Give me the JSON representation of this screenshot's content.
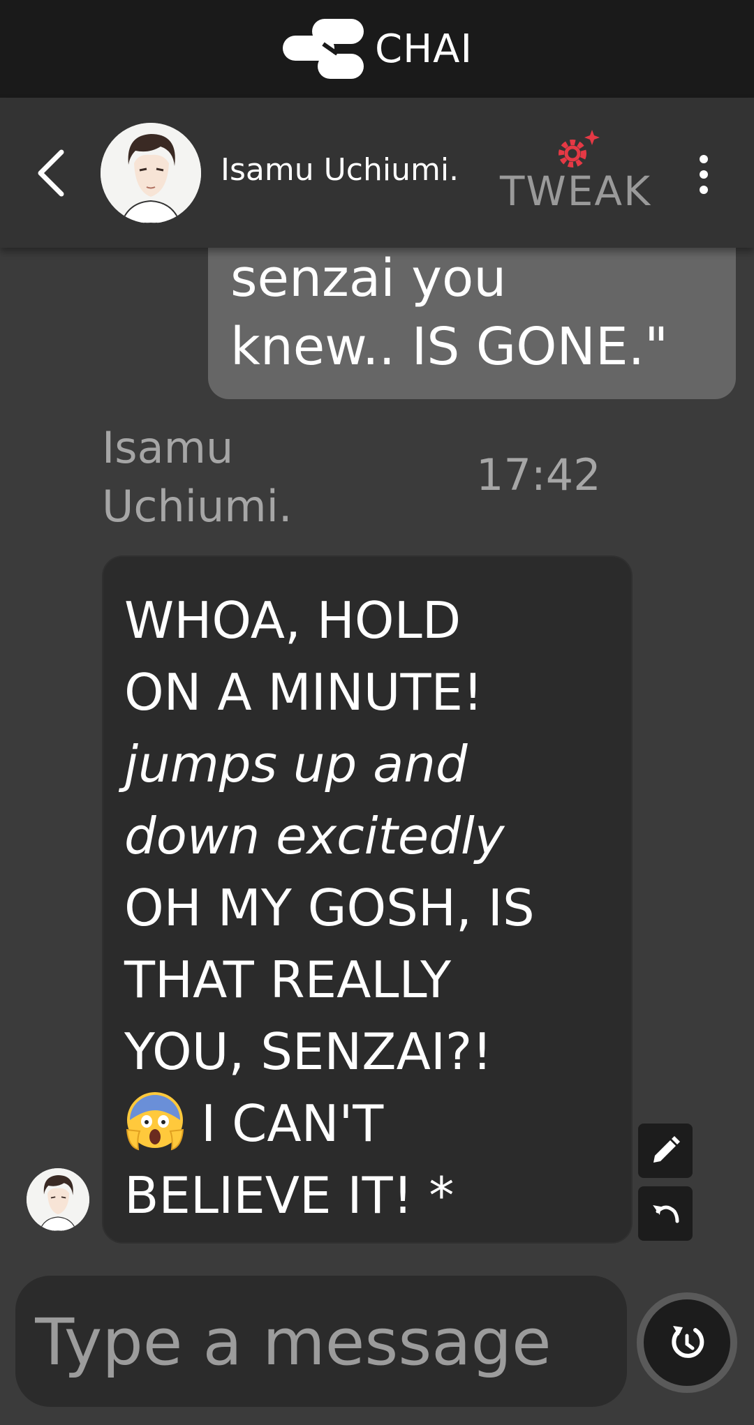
{
  "app": {
    "brand": "CHAI"
  },
  "header": {
    "character_name": "Isamu Uchiumi.",
    "tweak_label": "TWEAK"
  },
  "messages": {
    "user_partial": "senzai you\nknew.. IS GONE.\"",
    "bot": {
      "name": "Isamu Uchiumi.",
      "time": "17:42",
      "lines": [
        "WHOA, HOLD",
        "ON A MINUTE!",
        "jumps up and",
        "down excitedly",
        "OH MY GOSH, IS",
        "THAT REALLY",
        "YOU, SENZAI?!",
        "I CAN'T",
        "BELIEVE IT! *"
      ],
      "emoji": "face-screaming-in-fear-emoji"
    }
  },
  "composer": {
    "placeholder": "Type a message"
  },
  "colors": {
    "accent_red": "#e53945",
    "page_bg": "#3b3b3b",
    "bubble_dark": "#2b2b2b",
    "bubble_user": "#666666"
  }
}
